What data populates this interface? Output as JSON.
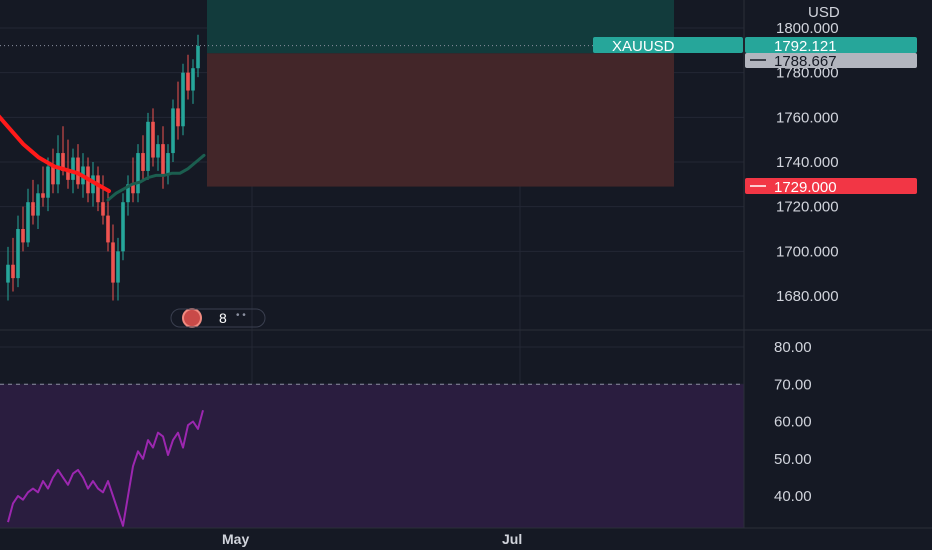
{
  "colors": {
    "background": "#151924",
    "grid": "#232734",
    "up": "#26a69a",
    "down": "#ef5350",
    "profit_zone": "#123b3c",
    "loss_zone": "#432629",
    "rsi_band": "#2a1d3f",
    "rsi_line": "#9c27b0",
    "ma_fast": "#ff1a1a",
    "ma_slow": "#1b5e4f",
    "axis_text": "#d1d4dc",
    "current_price_tag": "#26a69a",
    "entry_tag": "#b2b5be",
    "stop_tag": "#f23645"
  },
  "price_axis": {
    "currency": "USD",
    "ticks": [
      "1800.000",
      "1780.000",
      "1760.000",
      "1740.000",
      "1720.000",
      "1700.000",
      "1680.000"
    ],
    "tick_values": [
      1800,
      1780,
      1760,
      1740,
      1720,
      1700,
      1680
    ]
  },
  "rsi_axis": {
    "ticks": [
      "80.00",
      "70.00",
      "60.00",
      "50.00",
      "40.00"
    ],
    "tick_values": [
      80,
      70,
      60,
      50,
      40
    ]
  },
  "time_axis": {
    "labels": [
      "May",
      "Jul"
    ]
  },
  "tags": {
    "symbol": "XAUUSD",
    "current_price": "1792.121",
    "current_price_value": 1792.121,
    "entry_price": "1788.667",
    "entry_price_value": 1788.667,
    "stop_price": "1729.000",
    "stop_price_value": 1729.0
  },
  "events_badge": "8",
  "chart_data": {
    "type": "candlestick",
    "title": "",
    "symbol": "XAUUSD",
    "ylabel": "USD",
    "ylim": [
      1665,
      1808
    ],
    "candles_ohlc": [
      [
        1686,
        1702,
        1678,
        1694
      ],
      [
        1694,
        1706,
        1682,
        1688
      ],
      [
        1688,
        1716,
        1684,
        1710
      ],
      [
        1710,
        1720,
        1700,
        1704
      ],
      [
        1704,
        1728,
        1702,
        1722
      ],
      [
        1722,
        1732,
        1712,
        1716
      ],
      [
        1716,
        1730,
        1710,
        1726
      ],
      [
        1726,
        1738,
        1720,
        1724
      ],
      [
        1724,
        1742,
        1718,
        1738
      ],
      [
        1738,
        1746,
        1726,
        1730
      ],
      [
        1730,
        1752,
        1726,
        1744
      ],
      [
        1744,
        1756,
        1734,
        1736
      ],
      [
        1736,
        1750,
        1728,
        1732
      ],
      [
        1732,
        1746,
        1726,
        1742
      ],
      [
        1742,
        1748,
        1728,
        1730
      ],
      [
        1730,
        1744,
        1724,
        1738
      ],
      [
        1738,
        1742,
        1722,
        1726
      ],
      [
        1726,
        1740,
        1720,
        1734
      ],
      [
        1734,
        1738,
        1718,
        1722
      ],
      [
        1722,
        1734,
        1712,
        1716
      ],
      [
        1716,
        1728,
        1700,
        1704
      ],
      [
        1704,
        1712,
        1678,
        1686
      ],
      [
        1686,
        1706,
        1678,
        1700
      ],
      [
        1700,
        1726,
        1696,
        1722
      ],
      [
        1722,
        1734,
        1716,
        1730
      ],
      [
        1730,
        1742,
        1722,
        1726
      ],
      [
        1726,
        1748,
        1722,
        1744
      ],
      [
        1744,
        1752,
        1732,
        1736
      ],
      [
        1736,
        1762,
        1732,
        1758
      ],
      [
        1758,
        1764,
        1738,
        1742
      ],
      [
        1742,
        1752,
        1736,
        1748
      ],
      [
        1748,
        1756,
        1728,
        1734
      ],
      [
        1734,
        1748,
        1730,
        1744
      ],
      [
        1744,
        1768,
        1740,
        1764
      ],
      [
        1764,
        1776,
        1750,
        1756
      ],
      [
        1756,
        1784,
        1752,
        1780
      ],
      [
        1780,
        1788,
        1768,
        1772
      ],
      [
        1772,
        1786,
        1766,
        1782
      ],
      [
        1782,
        1797,
        1778,
        1792
      ]
    ],
    "ma_fast": {
      "name": "",
      "values": [
        1764,
        1760,
        1756,
        1752,
        1748,
        1745,
        1742,
        1740,
        1738,
        1737,
        1736,
        1735,
        1733,
        1731,
        1729,
        1727
      ]
    },
    "ma_slow": {
      "name": "",
      "values": [
        1723,
        1726,
        1728,
        1730,
        1731,
        1733,
        1734,
        1734,
        1735,
        1735,
        1737,
        1740,
        1743
      ]
    },
    "rsi": {
      "name": "",
      "ylim": [
        35,
        83
      ],
      "overbought": 70,
      "values": [
        33,
        38,
        40,
        39,
        41,
        42,
        41,
        44,
        42,
        45,
        47,
        45,
        43,
        46,
        47,
        45,
        42,
        44,
        42,
        41,
        44,
        40,
        36,
        32,
        40,
        48,
        52,
        50,
        55,
        53,
        57,
        56,
        51,
        55,
        57,
        53,
        59,
        60,
        58,
        63
      ]
    },
    "position": {
      "entry": 1788.667,
      "stop": 1729.0,
      "target_above_range": true
    }
  }
}
